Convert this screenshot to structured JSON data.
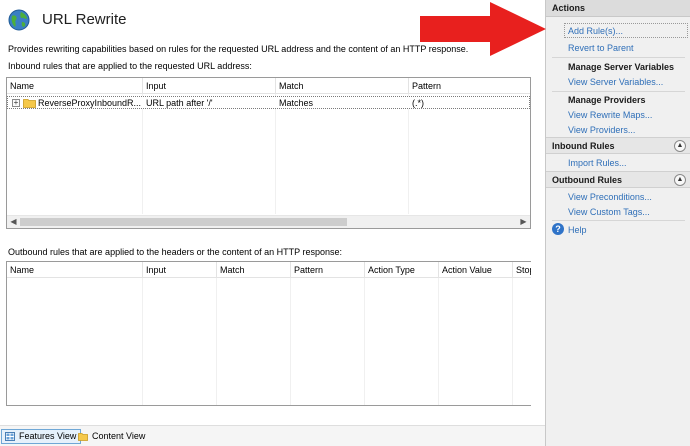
{
  "main": {
    "title": "URL Rewrite",
    "description": "Provides rewriting capabilities based on rules for the requested URL address and the content of an HTTP response.",
    "inbound_caption": "Inbound rules that are applied to the requested URL address:",
    "inbound_columns": [
      "Name",
      "Input",
      "Match",
      "Pattern"
    ],
    "inbound_rows": [
      {
        "name": "ReverseProxyInboundR...",
        "input": "URL path after '/'",
        "match": "Matches",
        "pattern": "(.*)"
      }
    ],
    "outbound_caption": "Outbound rules that are applied to the headers or the content of an HTTP response:",
    "outbound_columns": [
      "Name",
      "Input",
      "Match",
      "Pattern",
      "Action Type",
      "Action Value",
      "Stop"
    ]
  },
  "bottom_tabs": {
    "features": "Features View",
    "content": "Content View"
  },
  "actions": {
    "header": "Actions",
    "add_rule": "Add Rule(s)...",
    "revert": "Revert to Parent",
    "manage_server_variables": "Manage Server Variables",
    "view_server_variables": "View Server Variables...",
    "manage_providers": "Manage Providers",
    "view_rewrite_maps": "View Rewrite Maps...",
    "view_providers": "View Providers...",
    "inbound_rules": "Inbound Rules",
    "import_rules": "Import Rules...",
    "outbound_rules": "Outbound Rules",
    "view_preconditions": "View Preconditions...",
    "view_custom_tags": "View Custom Tags...",
    "help": "Help"
  },
  "colors": {
    "link": "#2f6fb8",
    "arrow": "#e8201e",
    "selected_tab": "#e6f1fb"
  }
}
